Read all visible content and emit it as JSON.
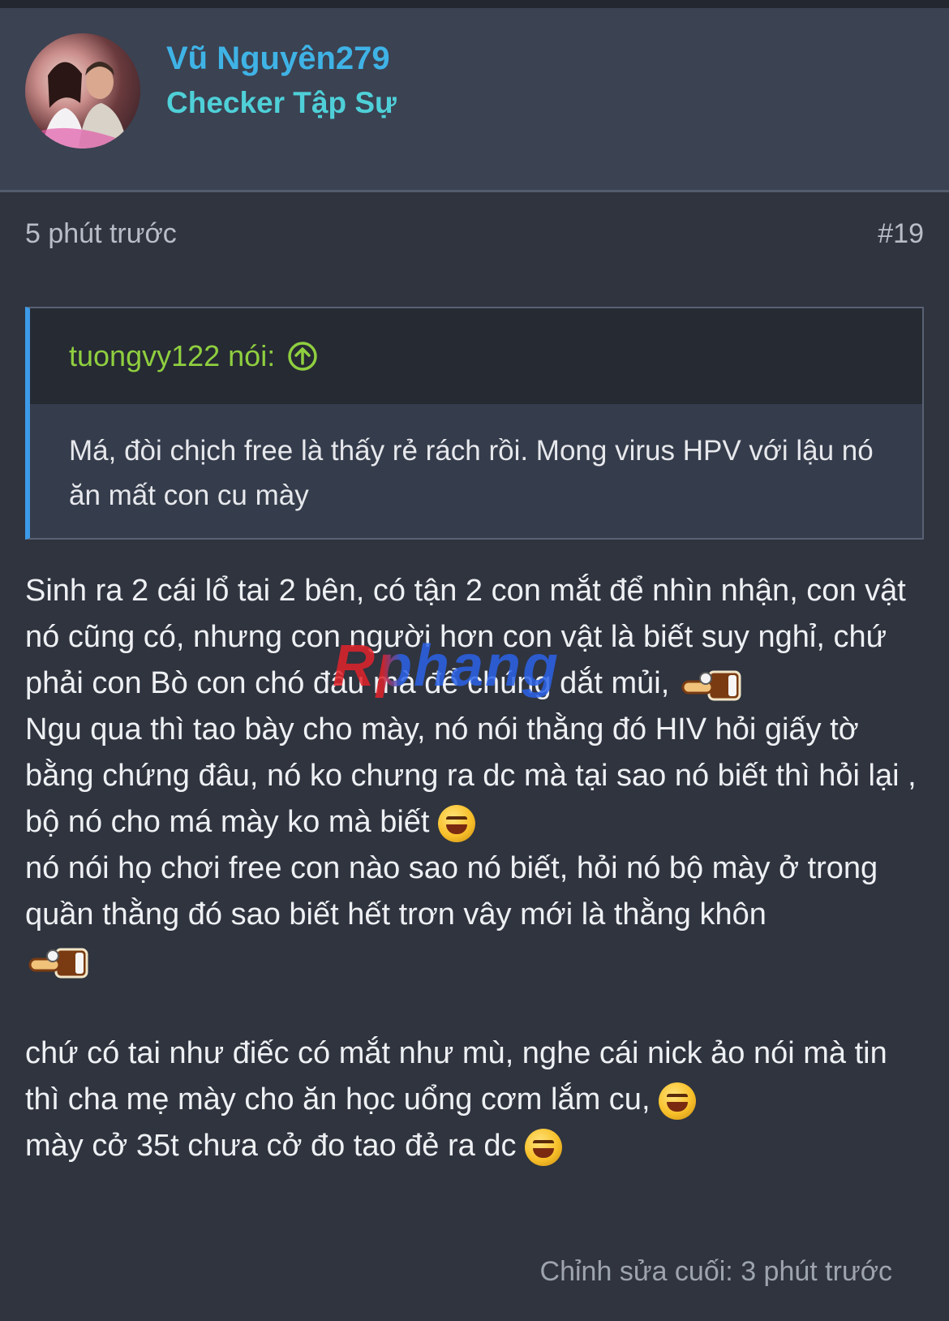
{
  "user": {
    "name": "Vũ Nguyên279",
    "title": "Checker Tập Sự"
  },
  "post": {
    "time": "5 phút trước",
    "number": "#19",
    "edited": "Chỉnh sửa cuối: 3 phút trước"
  },
  "quote": {
    "author": "tuongvy122 nói:",
    "body": "Má, đòi chịch free là thấy rẻ rách rồi. Mong virus HPV với lậu nó ăn mất con cu mày"
  },
  "body": {
    "p1": "Sinh ra 2 cái lổ tai 2 bên, có tận 2 con mắt để nhìn nhận, con vật nó cũng có, nhưng con người hơn con vật là biết suy nghỉ, chứ phải con Bò con chó đâu mà để chúng dắt mủi,",
    "p2": "Ngu qua thì tao bày cho mày, nó nói thằng đó HIV hỏi giấy tờ bằng chứng đâu, nó ko chưng ra dc mà tại sao nó biết thì hỏi lại , bộ nó cho má mày ko mà biết",
    "p3": "nó nói họ chơi free con nào sao nó biết, hỏi nó bộ mày ở trong quần thằng đó sao biết hết trơn vây mới là thằng khôn",
    "p4": "chứ có tai như điếc có mắt như mù, nghe cái nick ảo nói mà tin thì cha mẹ mày cho ăn học uổng cơm lắm cu,",
    "p5": "mày cở 35t chưa cở đo tao đẻ ra dc"
  },
  "watermark": "Rphang",
  "icons": {
    "quote_link": "arrow-up-circle-icon",
    "laugh": "laughing-emoji-icon",
    "sticker": "pointing-sticker-icon"
  },
  "colors": {
    "background": "#2f343f",
    "username": "#3fb3e6",
    "user_title": "#4fd0d8",
    "quote_author": "#8fcf3f",
    "quote_accent": "#3d9ae8"
  }
}
